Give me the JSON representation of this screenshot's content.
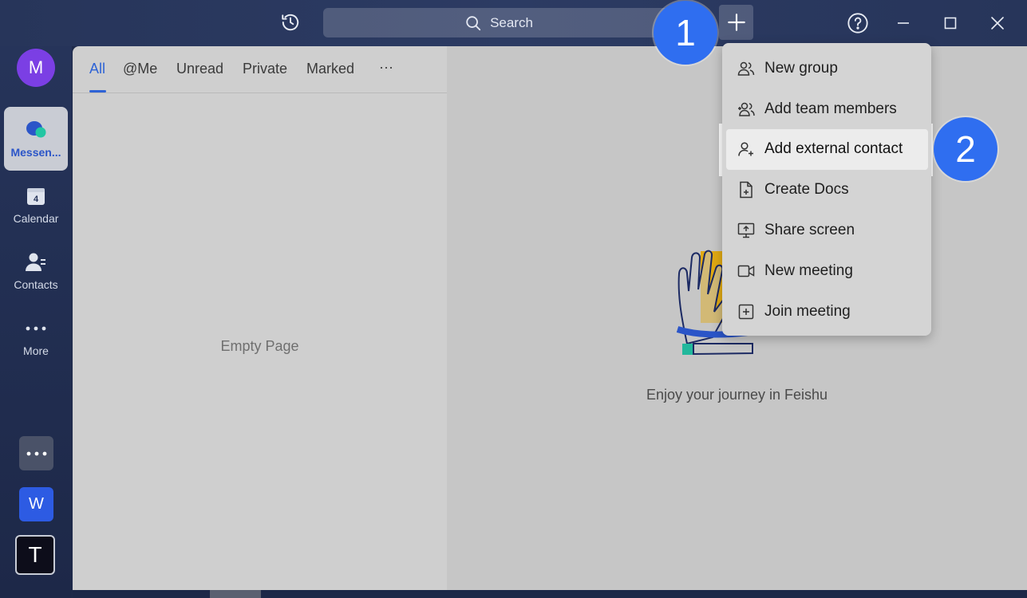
{
  "topbar": {
    "search_label": "Search",
    "icons": [
      "history-icon",
      "search-icon",
      "plus-icon",
      "help-icon",
      "minimize-icon",
      "maximize-icon",
      "close-icon"
    ]
  },
  "rail": {
    "avatar_letter": "M",
    "items": [
      {
        "label": "Messen...",
        "icon": "messenger-icon"
      },
      {
        "label": "Calendar",
        "icon": "calendar-icon",
        "badge": "4"
      },
      {
        "label": "Contacts",
        "icon": "contacts-icon"
      },
      {
        "label": "More",
        "icon": "more-icon"
      }
    ],
    "apps": [
      {
        "icon": "more-apps-icon"
      },
      {
        "letter": "W",
        "color": "#2d5be3"
      },
      {
        "letter": "T",
        "color": "#0d0d1a"
      }
    ]
  },
  "tabs": [
    {
      "label": "All"
    },
    {
      "label": "@Me"
    },
    {
      "label": "Unread"
    },
    {
      "label": "Private"
    },
    {
      "label": "Marked"
    },
    {
      "label": "···"
    }
  ],
  "list": {
    "empty_text": "Empty Page"
  },
  "welcome": {
    "text": "Enjoy your journey in Feishu"
  },
  "menu": {
    "items": [
      {
        "label": "New group",
        "icon": "group-icon"
      },
      {
        "label": "Add team members",
        "icon": "add-team-icon"
      },
      {
        "label": "Add external contact",
        "icon": "add-contact-icon"
      },
      {
        "label": "Create Docs",
        "icon": "create-doc-icon"
      },
      {
        "label": "Share screen",
        "icon": "share-screen-icon"
      },
      {
        "label": "New meeting",
        "icon": "video-icon"
      },
      {
        "label": "Join meeting",
        "icon": "join-meeting-icon"
      }
    ]
  },
  "badges": [
    "1",
    "2"
  ],
  "colors": {
    "accent": "#2e63d6",
    "badge": "#2f6ef0",
    "avatar": "#7b3fe4"
  }
}
